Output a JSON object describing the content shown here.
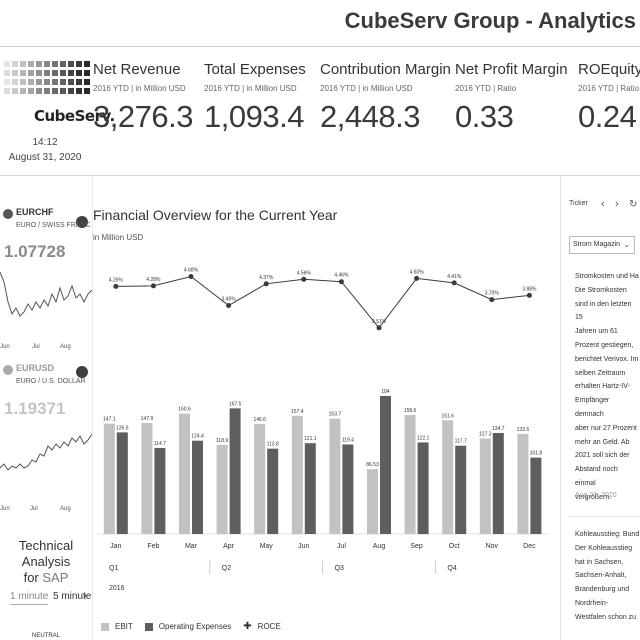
{
  "app_title": "CubeServ Group - Analytics",
  "logo": {
    "name": "CubeServ."
  },
  "clock": {
    "time": "14:12",
    "date": "August 31, 2020"
  },
  "kpis": [
    {
      "title": "Net Revenue",
      "subtitle": "2016 YTD | in Million USD",
      "value": "3,276.3"
    },
    {
      "title": "Total Expenses",
      "subtitle": "2016 YTD | in Million USD",
      "value": "1,093.4"
    },
    {
      "title": "Contribution Margin",
      "subtitle": "2016 YTD | in Million USD",
      "value": "2,448.3"
    },
    {
      "title": "Net Profit Margin",
      "subtitle": "2016 YTD | Ratio",
      "value": "0.33"
    },
    {
      "title": "ROEquity",
      "subtitle": "2016 YTD | Ratio",
      "value": "0.24"
    }
  ],
  "currencies": [
    {
      "code": "EURCHF",
      "name": "EURO / SWISS FRANC",
      "rate": "1.07728",
      "month_labels": [
        "Jun",
        "Jul",
        "Aug"
      ]
    },
    {
      "code": "EURUSD",
      "name": "EURO / U.S. DOLLAR",
      "rate": "1.19371",
      "month_labels": [
        "Jun",
        "Jul",
        "Aug"
      ]
    }
  ],
  "technical_analysis": {
    "title_line1": "Technical Analysis",
    "title_for": "for",
    "title_symbol": "SAP",
    "intervals": [
      "1 minute",
      "5 minute"
    ],
    "next_icon": "chevron-right-icon",
    "signal": "NEUTRAL"
  },
  "chart_data": {
    "type": "bar",
    "title": "Financial Overview for the Current Year",
    "subtitle": "in Million USD",
    "categories": [
      "Jan",
      "Feb",
      "Mar",
      "Apr",
      "May",
      "Jun",
      "Jul",
      "Aug",
      "Sep",
      "Oct",
      "Nov",
      "Dec"
    ],
    "quarters": [
      "Q1",
      "Q2",
      "Q3",
      "Q4"
    ],
    "year": "2016",
    "series": [
      {
        "name": "EBIT",
        "color": "#c2c2c2",
        "values": [
          147.1,
          147.9,
          160.6,
          118.9,
          146.6,
          157.4,
          153.7,
          86.53,
          158.6,
          151.6,
          127.3,
          133.6
        ],
        "labels": [
          "147.1",
          "147.9",
          "160.6",
          "118.9",
          "146.6",
          "157.4",
          "153.7",
          "86.53",
          "158.6",
          "151.6",
          "127.3",
          "133.6"
        ]
      },
      {
        "name": "Operating Expenses",
        "color": "#5e5e5e",
        "values": [
          135.5,
          114.7,
          124.4,
          167.5,
          113.8,
          121.1,
          119.4,
          184,
          122.1,
          117.7,
          134.7,
          101.8
        ],
        "labels": [
          "135.5",
          "114.7",
          "124.4",
          "167.5",
          "113.8",
          "121.1",
          "119.4",
          "184",
          "122.1",
          "117.7",
          "134.7",
          "101.8"
        ]
      },
      {
        "name": "ROCE",
        "color": "#3a3a3a",
        "values": [
          4.26,
          4.28,
          4.68,
          3.45,
          4.37,
          4.56,
          4.46,
          2.51,
          4.6,
          4.41,
          3.7,
          3.88
        ],
        "labels": [
          "4.26%",
          "4.28%",
          "4.68%",
          "3.45%",
          "4.37%",
          "4.56%",
          "4.46%",
          "2.51%",
          "4.60%",
          "4.41%",
          "3.70%",
          "3.88%"
        ]
      }
    ],
    "legend_position": "bottom-left"
  },
  "news_panel": {
    "ticker_label": "Ticker",
    "nav_icons": [
      "chevron-left-icon",
      "chevron-right-icon",
      "refresh-icon"
    ],
    "source": "Strom Magazin",
    "items": [
      {
        "lines": [
          "Stromkosten und Hartz-",
          "Die Stromkosten",
          "sind in den letzten 15",
          "Jahren um 61",
          "Prozent gestiegen,",
          "berichtet Verivox. Im",
          "selben Zeitraum",
          "erhalten Hartz-IV-",
          "Empfänger demnach",
          "aber nur 27 Prozent",
          "mehr an Geld. Ab",
          "2021 soll sich der",
          "Abstand noch einmal",
          "vergrößern."
        ],
        "date": "Aug 31, 2020"
      },
      {
        "lines": [
          "Kohleausstieg: Bund unv",
          "Der Kohleausstieg",
          "hat in Sachsen,",
          "Sachsen-Anhalt,",
          "Brandenburg und",
          "Nordrhein-",
          "Westfalen schon zu"
        ]
      }
    ]
  }
}
